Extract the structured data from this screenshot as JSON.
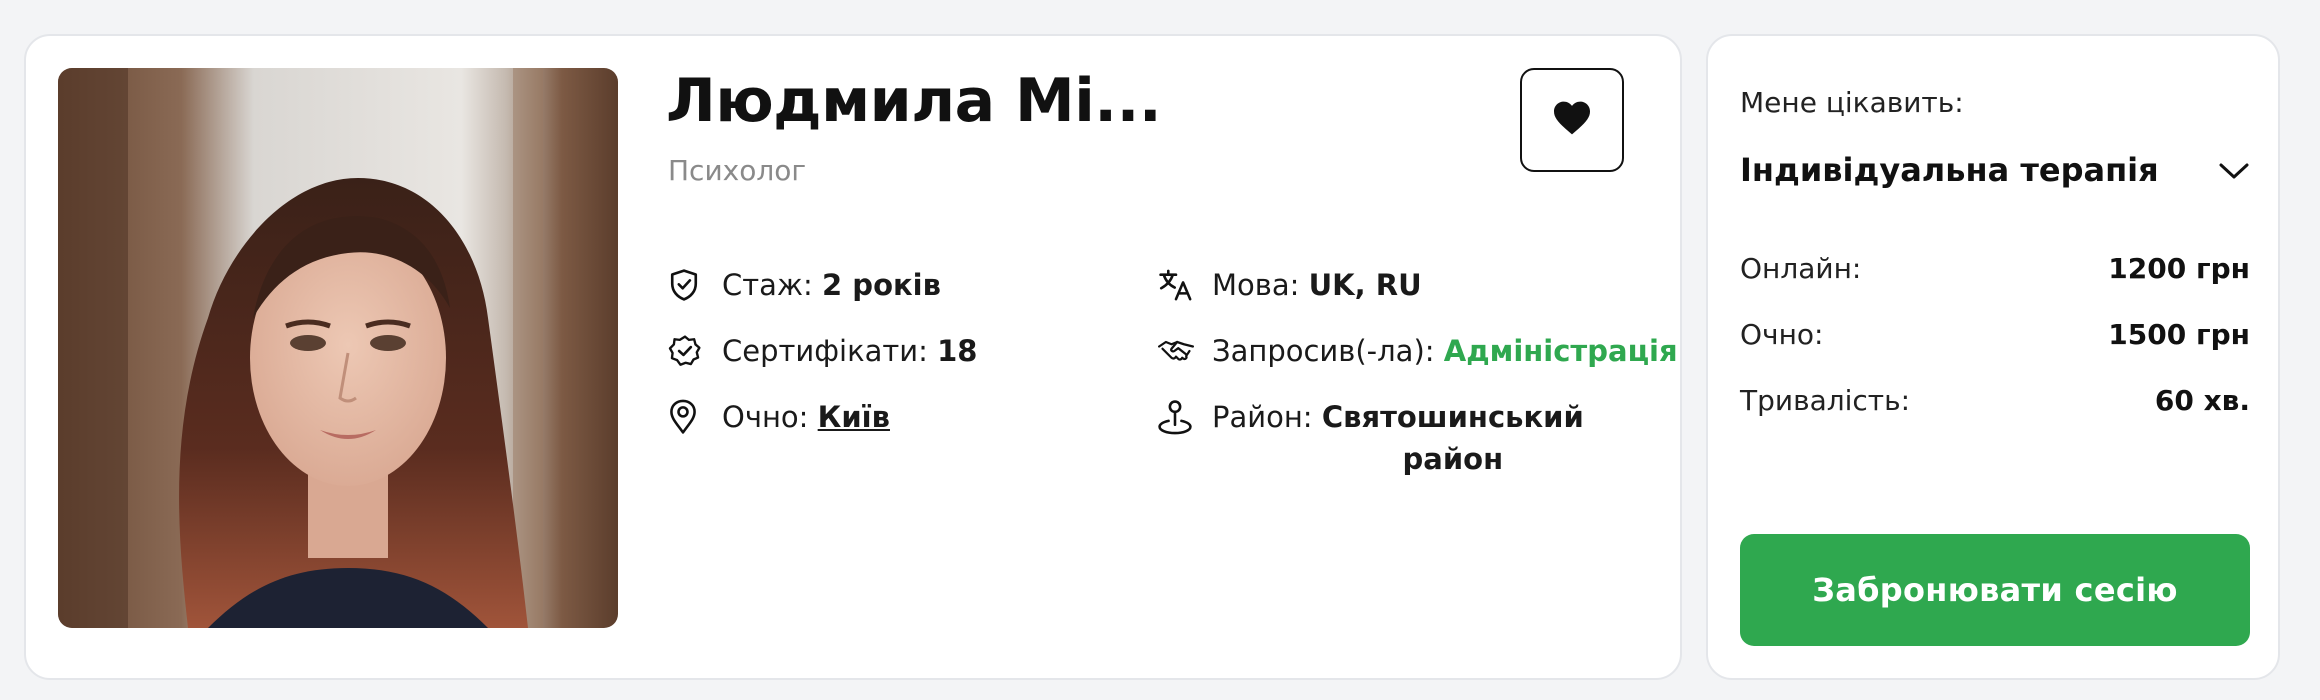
{
  "profile": {
    "name": "Людмила Мі...",
    "role": "Психолог",
    "experience": {
      "label": "Стаж: ",
      "value": "2 років"
    },
    "certificates": {
      "label": "Сертифікати: ",
      "value": "18"
    },
    "in_person": {
      "label": "Очно: ",
      "value": "Київ"
    },
    "language": {
      "label": "Мова: ",
      "value": "UK, RU"
    },
    "invited_by": {
      "label": "Запросив(-ла): ",
      "value": "Адміністрація"
    },
    "district": {
      "label": "Район: ",
      "value_line1": "Святошинський",
      "value_line2": "район"
    }
  },
  "booking": {
    "interest_label": "Мене цікавить:",
    "selected_therapy": "Індивідуальна терапія",
    "prices": [
      {
        "label": "Онлайн:",
        "value": "1200 грн"
      },
      {
        "label": "Очно:",
        "value": "1500 грн"
      },
      {
        "label": "Тривалість:",
        "value": "60 хв."
      }
    ],
    "book_button": "Забронювати сесію"
  },
  "colors": {
    "accent": "#2fa84f",
    "muted": "#8a8a8a",
    "border": "#e4e6ea",
    "background": "#f3f4f6"
  },
  "icons": [
    "shield-check-icon",
    "badge-check-icon",
    "location-pin-icon",
    "translate-icon",
    "handshake-icon",
    "map-pin-person-icon",
    "heart-icon",
    "chevron-down-icon"
  ]
}
